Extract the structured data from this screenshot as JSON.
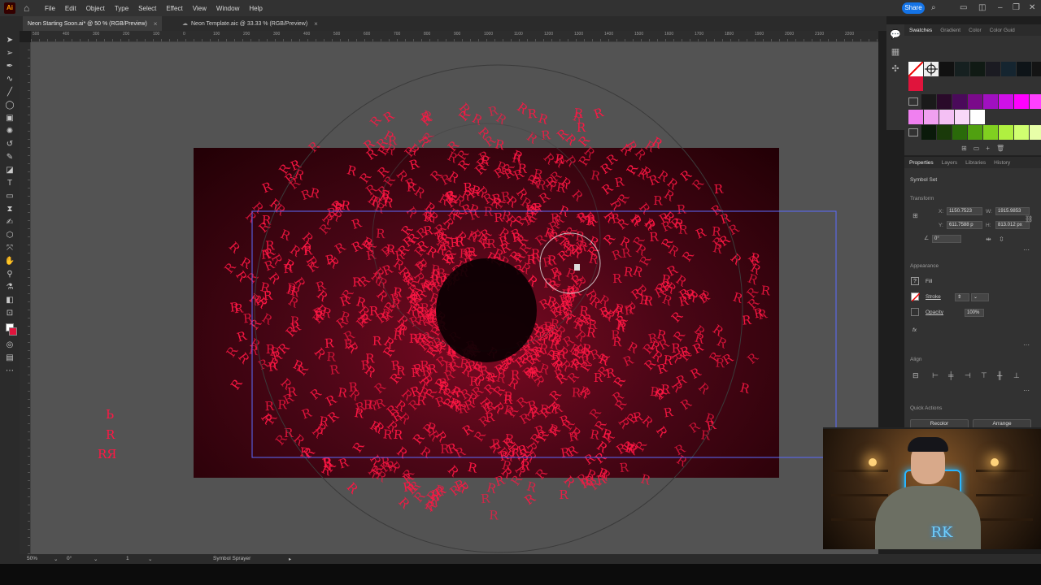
{
  "app": {
    "logo": "Ai"
  },
  "menu": [
    "File",
    "Edit",
    "Object",
    "Type",
    "Select",
    "Effect",
    "View",
    "Window",
    "Help"
  ],
  "share_label": "Share",
  "tabs": [
    {
      "label": "Neon Starting Soon.ai* @ 50 % (RGB/Preview)",
      "active": true
    },
    {
      "label": "Neon Template.aic @ 33.33 % (RGB/Preview)",
      "active": false
    }
  ],
  "ruler_ticks": [
    "500",
    "400",
    "300",
    "200",
    "100",
    "0",
    "100",
    "200",
    "300",
    "400",
    "500",
    "600",
    "700",
    "800",
    "900",
    "1000",
    "1100",
    "1200",
    "1300",
    "1400",
    "1500",
    "1600",
    "1700",
    "1800",
    "1900",
    "2000",
    "2100",
    "2200"
  ],
  "canvas": {
    "spray_glyph": "R",
    "stray_symbols": [
      "Ь",
      "R",
      "RЯ"
    ],
    "palette": {
      "artboard_edge": "#220005",
      "artboard_center": "#7a0a22",
      "spray": "#ff1744",
      "pasteboard": "#535353"
    }
  },
  "swatches_panel": {
    "tabs": [
      "Swatches",
      "Gradient",
      "Color",
      "Color Guid"
    ],
    "row1": [
      "#111111",
      "#162020",
      "#101a14",
      "#1b1b22",
      "#152530",
      "#0e1418",
      "#141414"
    ],
    "row2": [
      "#1a1a1a",
      "#2a0a2a",
      "#4a0a5a",
      "#7a0a8a",
      "#a010c0",
      "#d010e8",
      "#ff00ff",
      "#ff40ff"
    ],
    "row3": [
      "#f080f0",
      "#f0a0f0",
      "#f4c0f4",
      "#f8d8f8",
      "#ffffff"
    ],
    "row4": [
      "#0a1a0a",
      "#1a3a0a",
      "#2a6a0a",
      "#50a010",
      "#80d020",
      "#b0f040",
      "#d0ff70",
      "#e8ffa8"
    ]
  },
  "properties": {
    "tabs": [
      "Properties",
      "Layers",
      "Libraries",
      "History"
    ],
    "object_type": "Symbol Set",
    "transform_label": "Transform",
    "x_label": "X:",
    "x_value": "1150.7523",
    "y_label": "Y:",
    "y_value": "611.7588 p",
    "w_label": "W:",
    "w_value": "1915.9853",
    "h_label": "H:",
    "h_value": "813.012 px",
    "angle_value": "0°",
    "appearance_label": "Appearance",
    "fill_label": "Fill",
    "stroke_label": "Stroke",
    "opacity_label": "Opacity",
    "opacity_value": "100%",
    "fx_label": "fx",
    "align_label": "Align",
    "quick_actions_label": "Quick Actions",
    "recolor_label": "Recolor",
    "arrange_label": "Arrange"
  },
  "status": {
    "zoom": "50%",
    "angle": "0°",
    "artboard": "1",
    "tool": "Symbol Sprayer"
  },
  "webcam": {
    "logo_text": "RK"
  }
}
